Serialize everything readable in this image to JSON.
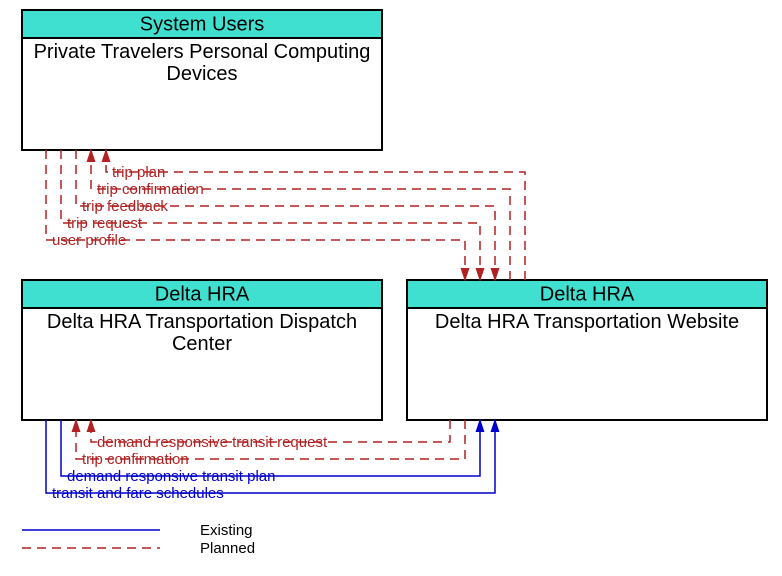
{
  "boxes": {
    "top": {
      "header": "System Users",
      "body1": "Private Travelers Personal Computing",
      "body2": "Devices"
    },
    "left": {
      "header": "Delta HRA",
      "body1": "Delta HRA Transportation Dispatch",
      "body2": "Center"
    },
    "right": {
      "header": "Delta HRA",
      "body1": "Delta HRA Transportation Website"
    }
  },
  "flows": {
    "trip_plan": "trip plan",
    "trip_confirmation_top": "trip confirmation",
    "trip_feedback": "trip feedback",
    "trip_request": "trip request",
    "user_profile": "user profile",
    "demand_resp_req": "demand responsive transit request",
    "trip_confirmation_bot": "trip confirmation",
    "demand_resp_plan": "demand responsive transit plan",
    "transit_fare": "transit and fare schedules"
  },
  "legend": {
    "existing": "Existing",
    "planned": "Planned"
  }
}
